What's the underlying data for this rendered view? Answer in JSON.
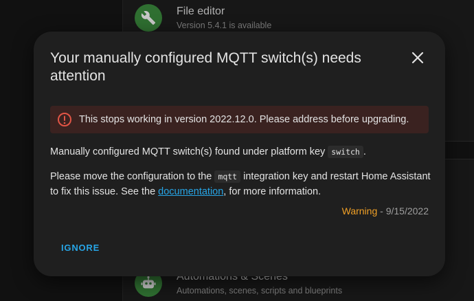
{
  "background": {
    "top_item": {
      "title": "File editor",
      "subtitle": "Version 5.4.1 is available",
      "icon": "wrench-icon"
    },
    "bottom_item": {
      "title": "Automations & Scenes",
      "subtitle": "Automations, scenes, scripts and blueprints",
      "icon": "robot-icon"
    }
  },
  "dialog": {
    "title": "Your manually configured MQTT switch(s) needs attention",
    "close_icon": "close-icon",
    "alert": {
      "icon": "error-circle-icon",
      "text": "This stops working in version 2022.12.0. Please address before upgrading."
    },
    "para1": {
      "before": "Manually configured MQTT switch(s) found under platform key",
      "code": "switch",
      "after": "."
    },
    "para2": {
      "before": "Please move the configuration to the",
      "code": "mqtt",
      "middle": "integration key and restart Home Assistant to fix this issue. See the",
      "link": "documentation",
      "after": ", for more information."
    },
    "severity": "Warning",
    "separator": " - ",
    "date": "9/15/2022",
    "ignore_label": "IGNORE"
  },
  "colors": {
    "accent": "#27a5e6",
    "warning": "#f0a026",
    "alert_bg": "#3a2220",
    "alert_icon": "#e25546",
    "icon_green": "#3d8f3f"
  }
}
